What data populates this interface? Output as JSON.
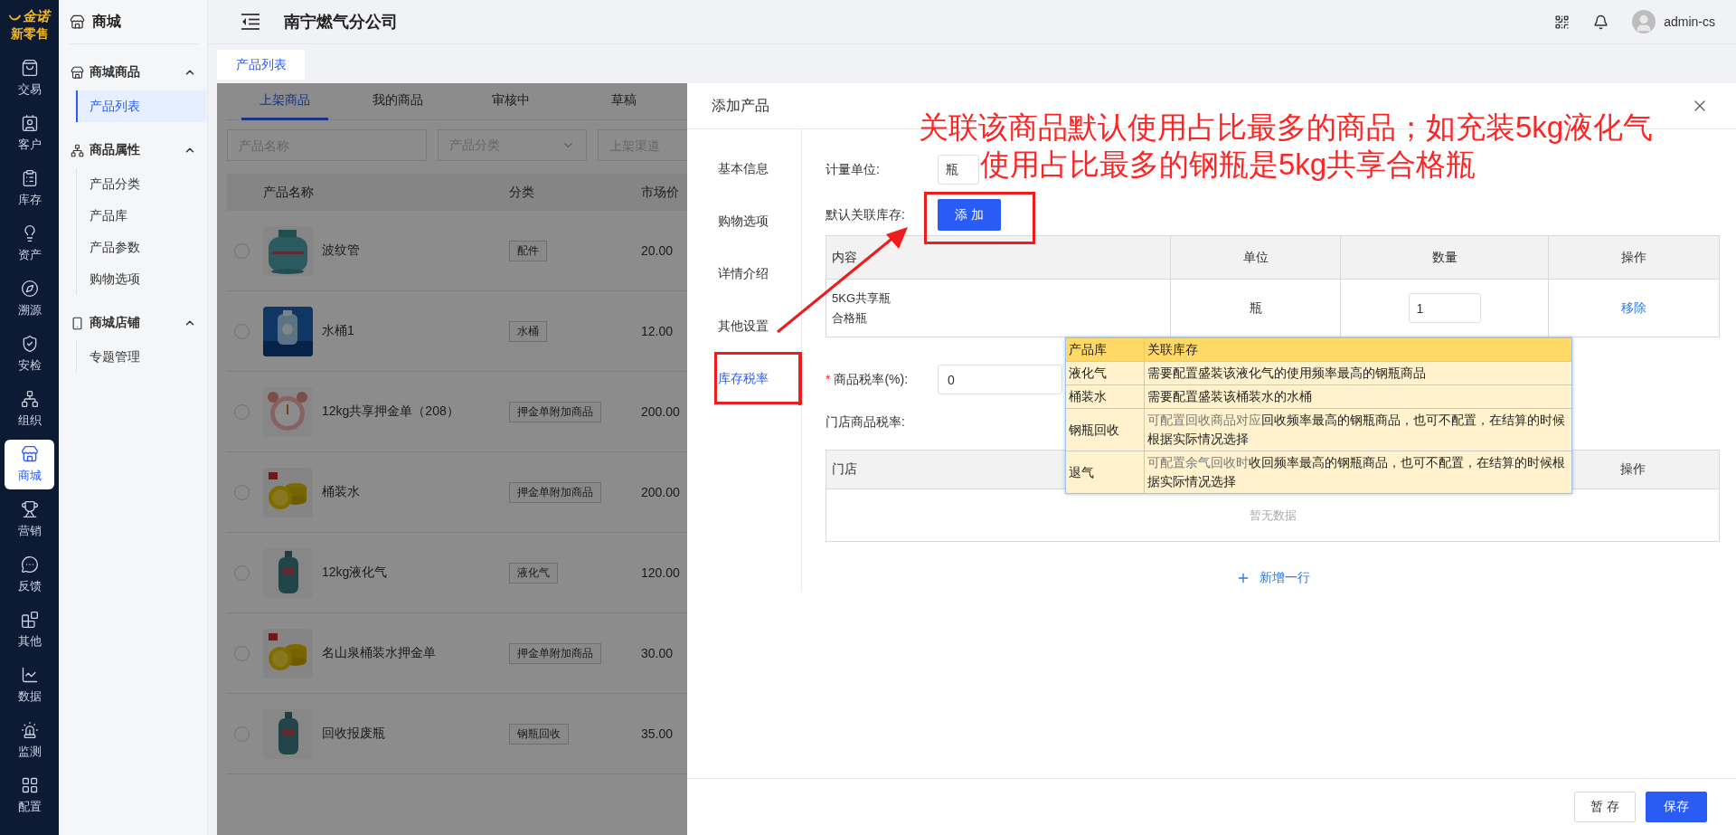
{
  "rail": {
    "logo": {
      "brand": "金诺",
      "tagline": "新零售"
    },
    "items": [
      {
        "label": "交易",
        "selected": false
      },
      {
        "label": "客户",
        "selected": false
      },
      {
        "label": "库存",
        "selected": false
      },
      {
        "label": "资产",
        "selected": false
      },
      {
        "label": "溯源",
        "selected": false
      },
      {
        "label": "安检",
        "selected": false
      },
      {
        "label": "组织",
        "selected": false
      },
      {
        "label": "商城",
        "selected": true
      },
      {
        "label": "营销",
        "selected": false
      },
      {
        "label": "反馈",
        "selected": false
      },
      {
        "label": "其他",
        "selected": false
      },
      {
        "label": "数据",
        "selected": false
      },
      {
        "label": "监测",
        "selected": false
      },
      {
        "label": "配置",
        "selected": false
      }
    ]
  },
  "sidebar": {
    "title": "商城",
    "groups": [
      {
        "label": "商城商品",
        "expanded": true,
        "children": [
          {
            "label": "产品列表",
            "selected": true
          }
        ]
      },
      {
        "label": "商品属性",
        "expanded": true,
        "children": [
          {
            "label": "产品分类",
            "selected": false
          },
          {
            "label": "产品库",
            "selected": false
          },
          {
            "label": "产品参数",
            "selected": false
          },
          {
            "label": "购物选项",
            "selected": false
          }
        ]
      },
      {
        "label": "商城店铺",
        "expanded": true,
        "children": [
          {
            "label": "专题管理",
            "selected": false
          }
        ]
      }
    ]
  },
  "header": {
    "title": "南宁燃气分公司",
    "user": "admin-cs"
  },
  "page_tabs": [
    {
      "label": "产品列表",
      "selected": true
    }
  ],
  "list": {
    "tabs": [
      {
        "label": "上架商品",
        "selected": true
      },
      {
        "label": "我的商品",
        "selected": false
      },
      {
        "label": "审核中",
        "selected": false
      },
      {
        "label": "草稿",
        "selected": false
      }
    ],
    "filters": [
      {
        "kind": "input",
        "placeholder": "产品名称"
      },
      {
        "kind": "select",
        "placeholder": "产品分类"
      },
      {
        "kind": "input",
        "placeholder": "上架渠道"
      }
    ],
    "columns": [
      "产品名称",
      "分类",
      "市场价"
    ],
    "rows": [
      {
        "name": "波纹管",
        "category": "配件",
        "price": "20.00",
        "selected": false
      },
      {
        "name": "水桶1",
        "category": "水桶",
        "price": "12.00",
        "selected": false
      },
      {
        "name": "12kg共享押金单（208）",
        "category": "押金单附加商品",
        "price": "200.00",
        "selected": false
      },
      {
        "name": "桶装水",
        "category": "押金单附加商品",
        "price": "200.00",
        "selected": false
      },
      {
        "name": "12kg液化气",
        "category": "液化气",
        "price": "120.00",
        "selected": false
      },
      {
        "name": "名山泉桶装水押金单",
        "category": "押金单附加商品",
        "price": "30.00",
        "selected": false
      },
      {
        "name": "回收报废瓶",
        "category": "钢瓶回收",
        "price": "35.00",
        "selected": false
      }
    ]
  },
  "dialog": {
    "title": "添加产品",
    "menu": [
      {
        "label": "基本信息",
        "selected": false
      },
      {
        "label": "购物选项",
        "selected": false
      },
      {
        "label": "详情介绍",
        "selected": false
      },
      {
        "label": "其他设置",
        "selected": false
      },
      {
        "label": "库存税率",
        "selected": true
      }
    ],
    "unit": {
      "label": "计量单位:",
      "value": "瓶"
    },
    "stock": {
      "label": "默认关联库存:",
      "button": "添 加",
      "columns": [
        "内容",
        "单位",
        "数量",
        "操作"
      ],
      "rows": [
        {
          "content": [
            "5KG共享瓶",
            "合格瓶"
          ],
          "unit": "瓶",
          "quantity": "1",
          "action": "移除"
        }
      ]
    },
    "tax": {
      "label": "商品税率(%):",
      "required_mark": "*",
      "value": "0"
    },
    "store_tax": {
      "label": "门店商品税率:",
      "columns": [
        "门店",
        "操作"
      ],
      "empty": "暂无数据",
      "add": "新增一行"
    },
    "buttons": [
      {
        "label": "暂 存",
        "kind": "default"
      },
      {
        "label": "保存",
        "kind": "primary"
      }
    ]
  },
  "note": {
    "lines": [
      "关联该商品默认使用占比最多的商品；如充装5kg液化气",
      "使用占比最多的钢瓶是5kg共享合格瓶"
    ],
    "table": {
      "columns": [
        "产品库",
        "关联库存"
      ],
      "rows": [
        {
          "name": "液化气",
          "text": "需要配置盛装该液化气的使用频率最高的钢瓶商品"
        },
        {
          "name": "桶装水",
          "text": "需要配置盛装该桶装水的水桶"
        },
        {
          "name": "钢瓶回收",
          "prefix": "可配置回收商品对应",
          "text": "回收频率最高的钢瓶商品，也可不配置，在结算的时候根据实际情况选择"
        },
        {
          "name": "退气",
          "prefix": "可配置余气回收时",
          "text": "收回频率最高的钢瓶商品，也可不配置，在结算的时候根据实际情况选择"
        }
      ]
    }
  }
}
